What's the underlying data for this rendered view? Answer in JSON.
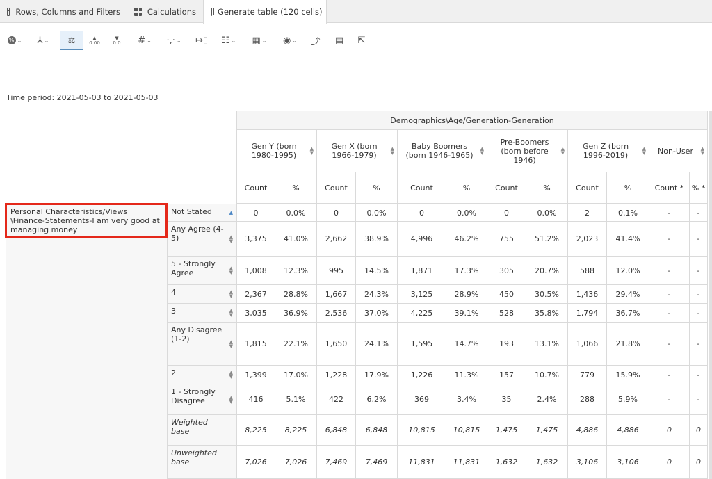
{
  "tabs": [
    {
      "label": "Rows, Columns and Filters",
      "icon": "table-icon"
    },
    {
      "label": "Calculations",
      "icon": "calculator-icon"
    },
    {
      "label": "Generate table (120 cells)",
      "icon": "table-icon"
    }
  ],
  "toolbar": {
    "icons": [
      "percent-icon",
      "chart-branch-icon",
      "balance-icon",
      "increase-decimal-icon",
      "decrease-decimal-icon",
      "hash-icon",
      "comma-icon",
      "column-width-icon",
      "table-layout-icon",
      "grid-icon",
      "hide-icon",
      "export-row-icon",
      "column-view-icon",
      "share-icon"
    ],
    "increase_decimal_label": "0.00",
    "decrease_decimal_label": "0.0",
    "active_icon": "balance-icon"
  },
  "time_period": "Time period: 2021-05-03 to 2021-05-03",
  "table": {
    "banner": "Demographics\\Age/Generation-Generation",
    "groups": [
      "Gen Y (born 1980-1995)",
      "Gen X (born 1966-1979)",
      "Baby Boomers (born 1946-1965)",
      "Pre-Boomers (born before 1946)",
      "Gen Z (born 1996-2019)",
      "Non-User"
    ],
    "subheaders": [
      [
        "Count",
        "%"
      ],
      [
        "Count",
        "%"
      ],
      [
        "Count",
        "%"
      ],
      [
        "Count",
        "%"
      ],
      [
        "Count",
        "%"
      ],
      [
        "Count *",
        "% *"
      ]
    ],
    "question": "Personal Characteristics/Views \\Finance-Statements-I am very good at managing money",
    "rows": [
      {
        "label": "Not Stated",
        "cells": [
          "0",
          "0.0%",
          "0",
          "0.0%",
          "0",
          "0.0%",
          "0",
          "0.0%",
          "2",
          "0.1%",
          "-",
          "-"
        ],
        "italic": false
      },
      {
        "label": "Any Agree (4-5)",
        "cells": [
          "3,375",
          "41.0%",
          "2,662",
          "38.9%",
          "4,996",
          "46.2%",
          "755",
          "51.2%",
          "2,023",
          "41.4%",
          "-",
          "-"
        ],
        "italic": false
      },
      {
        "label": "5 - Strongly Agree",
        "cells": [
          "1,008",
          "12.3%",
          "995",
          "14.5%",
          "1,871",
          "17.3%",
          "305",
          "20.7%",
          "588",
          "12.0%",
          "-",
          "-"
        ],
        "italic": false
      },
      {
        "label": "4",
        "cells": [
          "2,367",
          "28.8%",
          "1,667",
          "24.3%",
          "3,125",
          "28.9%",
          "450",
          "30.5%",
          "1,436",
          "29.4%",
          "-",
          "-"
        ],
        "italic": false
      },
      {
        "label": "3",
        "cells": [
          "3,035",
          "36.9%",
          "2,536",
          "37.0%",
          "4,225",
          "39.1%",
          "528",
          "35.8%",
          "1,794",
          "36.7%",
          "-",
          "-"
        ],
        "italic": false
      },
      {
        "label": "Any Disagree (1-2)",
        "cells": [
          "1,815",
          "22.1%",
          "1,650",
          "24.1%",
          "1,595",
          "14.7%",
          "193",
          "13.1%",
          "1,066",
          "21.8%",
          "-",
          "-"
        ],
        "italic": false
      },
      {
        "label": "2",
        "cells": [
          "1,399",
          "17.0%",
          "1,228",
          "17.9%",
          "1,226",
          "11.3%",
          "157",
          "10.7%",
          "779",
          "15.9%",
          "-",
          "-"
        ],
        "italic": false
      },
      {
        "label": "1 - Strongly Disagree",
        "cells": [
          "416",
          "5.1%",
          "422",
          "6.2%",
          "369",
          "3.4%",
          "35",
          "2.4%",
          "288",
          "5.9%",
          "-",
          "-"
        ],
        "italic": false
      },
      {
        "label": "Weighted base",
        "cells": [
          "8,225",
          "8,225",
          "6,848",
          "6,848",
          "10,815",
          "10,815",
          "1,475",
          "1,475",
          "4,886",
          "4,886",
          "0",
          "0"
        ],
        "italic": true
      },
      {
        "label": "Unweighted base",
        "cells": [
          "7,026",
          "7,026",
          "7,469",
          "7,469",
          "11,831",
          "11,831",
          "1,632",
          "1,632",
          "3,106",
          "3,106",
          "0",
          "0"
        ],
        "italic": true
      }
    ]
  }
}
